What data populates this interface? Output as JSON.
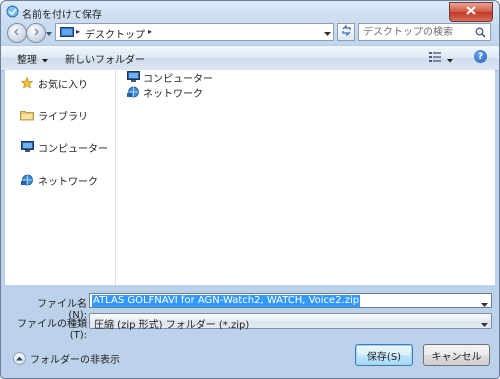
{
  "window": {
    "title": "名前を付けて保存",
    "title_icon": "save-dialog-icon",
    "close_icon": "close-icon"
  },
  "nav": {
    "back_icon": "back-arrow-icon",
    "forward_icon": "forward-arrow-icon",
    "address": {
      "location": "デスクトップ",
      "location_icon": "desktop-icon"
    },
    "refresh_icon": "refresh-icon",
    "search": {
      "placeholder": "デスクトップの検索"
    }
  },
  "commandbar": {
    "organize_label": "整理",
    "new_folder_label": "新しいフォルダー",
    "views_icon": "views-icon",
    "help_icon": "help-icon",
    "help_glyph": "?"
  },
  "sidebar": {
    "items": [
      {
        "label": "お気に入り",
        "icon": "star-icon"
      },
      {
        "label": "ライブラリ",
        "icon": "library-icon"
      },
      {
        "label": "コンピューター",
        "icon": "computer-icon"
      },
      {
        "label": "ネットワーク",
        "icon": "network-icon"
      }
    ]
  },
  "files": [
    {
      "label": "コンピューター",
      "icon": "computer-icon"
    },
    {
      "label": "ネットワーク",
      "icon": "network-icon"
    }
  ],
  "form": {
    "filename_label": "ファイル名(N):",
    "filename_value": "ATLAS GOLFNAVI for AGN-Watch2, WATCH, Voice2.zip",
    "filetype_label": "ファイルの種類(T):",
    "filetype_value": "圧縮 (zip 形式) フォルダー (*.zip)"
  },
  "footer": {
    "hide_folders_label": "フォルダーの非表示",
    "save_button": "保存(S)",
    "cancel_button": "キャンセル"
  },
  "colors": {
    "selection": "#3399ff",
    "close_button": "#c0392b",
    "chrome": "#bcd1ea"
  }
}
